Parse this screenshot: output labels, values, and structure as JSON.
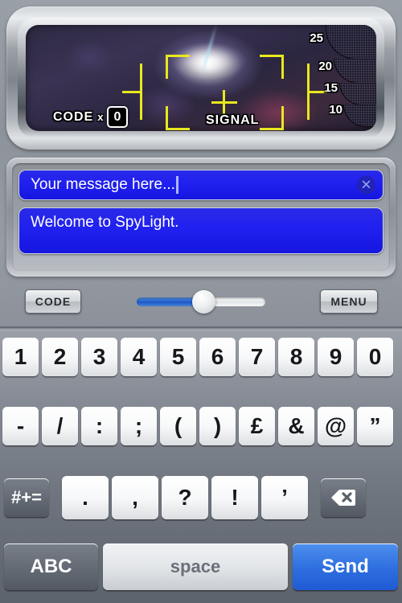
{
  "viewfinder": {
    "code_label": "CODE",
    "code_multiplier": "x",
    "code_value": "0",
    "signal_label": "SIGNAL",
    "meter_ticks": [
      "25",
      "20",
      "15",
      "10"
    ],
    "crosshair_color": "#e8e81e",
    "screen_bg": "#2e2a44"
  },
  "message": {
    "input_value": "Your message here...",
    "input_placeholder": "Your message here...",
    "clear_icon": "close-circle-icon",
    "clear_glyph": "✕",
    "received_text": "Welcome to SpyLight.",
    "field_color": "#2020f0"
  },
  "controls": {
    "code_button": "CODE",
    "menu_button": "MENU",
    "slider_percent": 52,
    "slider_fill_color": "#1f58c8"
  },
  "keyboard": {
    "row1": [
      "1",
      "2",
      "3",
      "4",
      "5",
      "6",
      "7",
      "8",
      "9",
      "0"
    ],
    "row2": [
      "-",
      "/",
      ":",
      ";",
      "(",
      ")",
      "£",
      "&",
      "@",
      "”"
    ],
    "row3_symbols": [
      ".",
      ",",
      "?",
      "!",
      "’"
    ],
    "symbol_toggle": "#+=",
    "backspace_icon": "backspace-icon",
    "alpha_toggle": "ABC",
    "space_key": "space",
    "send_key": "Send",
    "send_color": "#2f6fe0"
  }
}
